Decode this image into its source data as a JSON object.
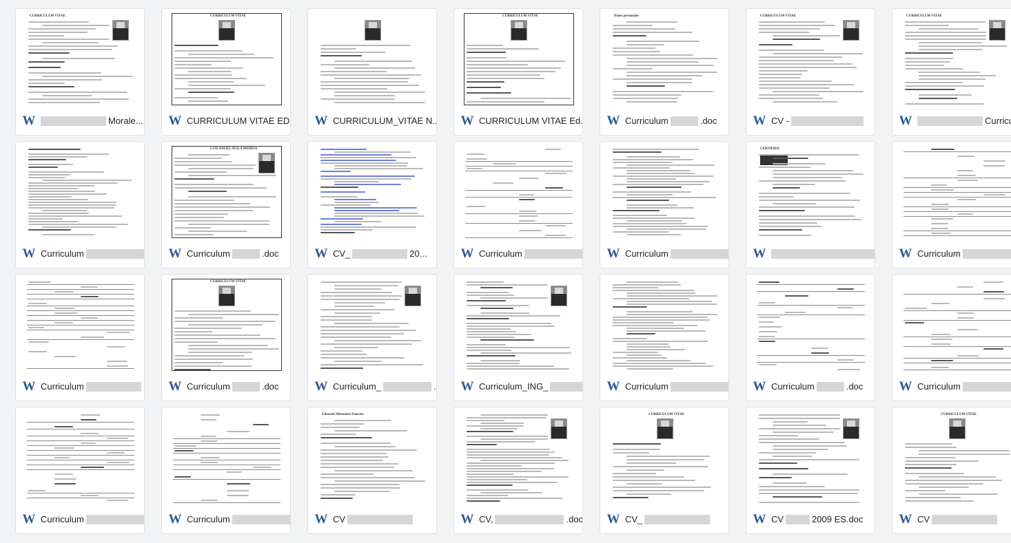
{
  "files": [
    {
      "parts": [
        {
          "r": 95
        },
        {
          "t": "Morale..."
        }
      ],
      "thumb": {
        "layout": "list",
        "photo": "right",
        "title": "CURRICULUM VITAE"
      }
    },
    {
      "parts": [
        {
          "t": "CURRICULUM VITAE ED..."
        }
      ],
      "thumb": {
        "layout": "boxed",
        "photo": "center",
        "title": "CURRICULUM VITAE"
      }
    },
    {
      "parts": [
        {
          "t": "CURRICULUM_VITAE N..."
        }
      ],
      "thumb": {
        "layout": "serif",
        "photo": "center",
        "title": ""
      }
    },
    {
      "parts": [
        {
          "t": "CURRICULUM VITAE Ed..."
        }
      ],
      "thumb": {
        "layout": "boxed",
        "photo": "center",
        "title": "CURRICULUM VITAE"
      }
    },
    {
      "parts": [
        {
          "t": "Curriculum"
        },
        {
          "r": 40
        },
        {
          "t": ".doc"
        }
      ],
      "thumb": {
        "layout": "sections",
        "photo": "none",
        "title": "Datos personales"
      }
    },
    {
      "parts": [
        {
          "t": "CV - "
        },
        {
          "r": 105
        }
      ],
      "thumb": {
        "layout": "serif",
        "photo": "right",
        "title": "CURRICULUM VITAE"
      }
    },
    {
      "parts": [
        {
          "r": 95
        },
        {
          "t": "Curricul..."
        }
      ],
      "thumb": {
        "layout": "list",
        "photo": "right",
        "title": "CURRICULUM VITAE"
      }
    },
    {
      "parts": [
        {
          "t": "Curriculum"
        },
        {
          "r": 85
        }
      ],
      "thumb": {
        "layout": "dense",
        "photo": "none",
        "title": ""
      }
    },
    {
      "parts": [
        {
          "t": "Curriculum"
        },
        {
          "r": 40
        },
        {
          "t": ".doc"
        }
      ],
      "thumb": {
        "layout": "boxed",
        "photo": "right",
        "title": "LUIS ANGEL AVILA MEDINA"
      }
    },
    {
      "parts": [
        {
          "t": "CV_"
        },
        {
          "r": 80
        },
        {
          "t": "20..."
        }
      ],
      "thumb": {
        "layout": "bluelist",
        "photo": "none",
        "title": ""
      }
    },
    {
      "parts": [
        {
          "t": "Curriculum"
        },
        {
          "r": 95
        }
      ],
      "thumb": {
        "layout": "table",
        "photo": "none",
        "title": ""
      }
    },
    {
      "parts": [
        {
          "t": "Curriculum"
        },
        {
          "r": 100
        }
      ],
      "thumb": {
        "layout": "dense",
        "photo": "none",
        "title": ""
      }
    },
    {
      "parts": [
        {
          "r": 150
        }
      ],
      "thumb": {
        "layout": "logo",
        "photo": "none",
        "title": "CERTIFIED"
      }
    },
    {
      "parts": [
        {
          "t": "Curriculum"
        },
        {
          "r": 95
        }
      ],
      "thumb": {
        "layout": "table",
        "photo": "none",
        "title": ""
      }
    },
    {
      "parts": [
        {
          "t": "Curriculum"
        },
        {
          "r": 80
        }
      ],
      "thumb": {
        "layout": "table",
        "photo": "none",
        "title": ""
      }
    },
    {
      "parts": [
        {
          "t": "Curriculum"
        },
        {
          "r": 40
        },
        {
          "t": ".doc"
        }
      ],
      "thumb": {
        "layout": "boxed",
        "photo": "center",
        "title": "CURRICULUM VITAE"
      }
    },
    {
      "parts": [
        {
          "t": "Curriculum_"
        },
        {
          "r": 70
        },
        {
          "t": ".doc"
        }
      ],
      "thumb": {
        "layout": "serif",
        "photo": "right",
        "title": ""
      }
    },
    {
      "parts": [
        {
          "t": "Curriculum_ING_"
        },
        {
          "r": 65
        }
      ],
      "thumb": {
        "layout": "dense",
        "photo": "right",
        "title": ""
      }
    },
    {
      "parts": [
        {
          "t": "Curriculum"
        },
        {
          "r": 95
        }
      ],
      "thumb": {
        "layout": "dense",
        "photo": "none",
        "title": ""
      }
    },
    {
      "parts": [
        {
          "t": "Curriculum"
        },
        {
          "r": 40
        },
        {
          "t": ".doc"
        }
      ],
      "thumb": {
        "layout": "table",
        "photo": "none",
        "title": ""
      }
    },
    {
      "parts": [
        {
          "t": "Curriculum"
        },
        {
          "r": 95
        }
      ],
      "thumb": {
        "layout": "table",
        "photo": "none",
        "title": ""
      }
    },
    {
      "parts": [
        {
          "t": "Curriculum"
        },
        {
          "r": 95
        }
      ],
      "thumb": {
        "layout": "table",
        "photo": "none",
        "title": ""
      }
    },
    {
      "parts": [
        {
          "t": "Curriculum"
        },
        {
          "r": 95
        }
      ],
      "thumb": {
        "layout": "table",
        "photo": "none",
        "title": ""
      }
    },
    {
      "parts": [
        {
          "t": "CV"
        },
        {
          "r": 95
        }
      ],
      "thumb": {
        "layout": "list",
        "photo": "none",
        "title": "Eduardo Meixueiro Palacios"
      }
    },
    {
      "parts": [
        {
          "t": "CV,"
        },
        {
          "r": 100
        },
        {
          "t": ".doc"
        }
      ],
      "thumb": {
        "layout": "dense",
        "photo": "right",
        "title": ""
      }
    },
    {
      "parts": [
        {
          "t": "CV_"
        },
        {
          "r": 95
        }
      ],
      "thumb": {
        "layout": "list",
        "photo": "center",
        "title": "CURRICULUM VITAE"
      }
    },
    {
      "parts": [
        {
          "t": "CV "
        },
        {
          "r": 35
        },
        {
          "t": "2009 ES.doc"
        }
      ],
      "thumb": {
        "layout": "list",
        "photo": "right",
        "title": ""
      }
    },
    {
      "parts": [
        {
          "t": "CV "
        },
        {
          "r": 95
        }
      ],
      "thumb": {
        "layout": "list",
        "photo": "center",
        "title": "CURRICULUM VITAE"
      }
    }
  ],
  "icons": {
    "file_type": "word-doc-icon",
    "glyph": "W",
    "color": "#2b579a"
  }
}
